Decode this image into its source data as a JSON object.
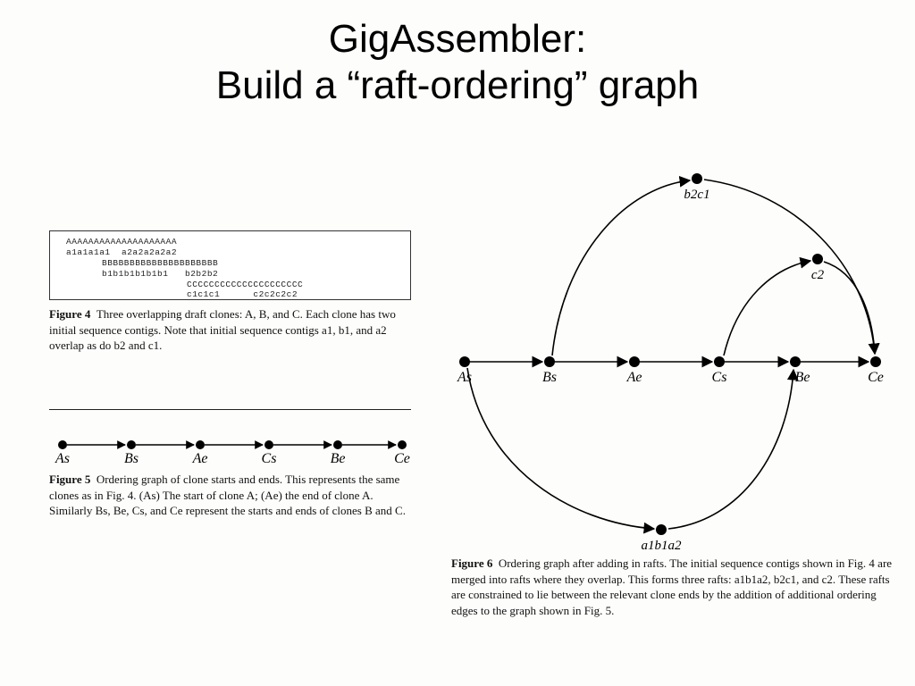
{
  "title_line1": "GigAssembler:",
  "title_line2": "Build a “raft-ordering” graph",
  "fig4": {
    "lines": {
      "l1": "AAAAAAAAAAAAAAAAAAAA",
      "l2": "a1a1a1a1  a2a2a2a2a2",
      "l3": "BBBBBBBBBBBBBBBBBBBBB",
      "l4": "b1b1b1b1b1b1   b2b2b2",
      "l5": "CCCCCCCCCCCCCCCCCCCCC",
      "l6": "c1c1c1      c2c2c2c2"
    },
    "caption_bold": "Figure 4",
    "caption_rest": "  Three overlapping draft clones: A, B, and C. Each clone has two initial sequence contigs. Note that initial sequence contigs a1, b1, and a2 overlap as do b2 and c1."
  },
  "fig5": {
    "nodes": [
      "As",
      "Bs",
      "Ae",
      "Cs",
      "Be",
      "Ce"
    ],
    "caption_bold": "Figure 5",
    "caption_rest": "  Ordering graph of clone starts and ends. This represents the same clones as in Fig. 4. (As) The start of clone A; (Ae) the end of clone A. Similarly Bs, Be, Cs, and Ce represent the starts and ends of clones B and C."
  },
  "fig6": {
    "line_nodes": [
      "As",
      "Bs",
      "Ae",
      "Cs",
      "Be",
      "Ce"
    ],
    "top_raft": "b2c1",
    "right_raft": "c2",
    "bottom_raft": "a1b1a2",
    "caption_bold": "Figure 6",
    "caption_rest": "  Ordering graph after adding in rafts. The initial sequence contigs shown in Fig. 4 are merged into rafts where they overlap. This forms three rafts: a1b1a2, b2c1, and c2. These rafts are constrained to lie between the relevant clone ends by the addition of additional ordering edges to the graph shown in Fig. 5."
  }
}
